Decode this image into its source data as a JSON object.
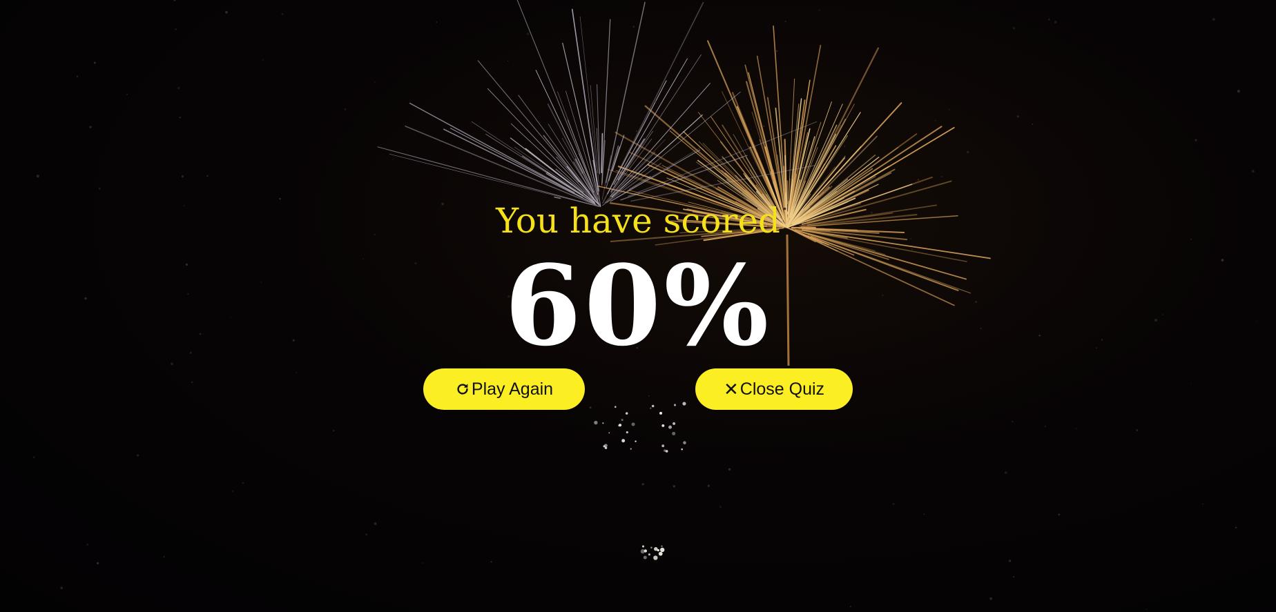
{
  "result": {
    "heading": "You have scored",
    "score": "60%"
  },
  "buttons": {
    "play_again": {
      "label": "Play Again",
      "icon": "redo-icon"
    },
    "close_quiz": {
      "label": "Close Quiz",
      "icon": "close-icon",
      "glyph": "✕"
    }
  },
  "colors": {
    "accent_yellow": "#fbee23",
    "heading_yellow": "#f5e11a",
    "score_white": "#ffffff",
    "background": "#050304"
  }
}
